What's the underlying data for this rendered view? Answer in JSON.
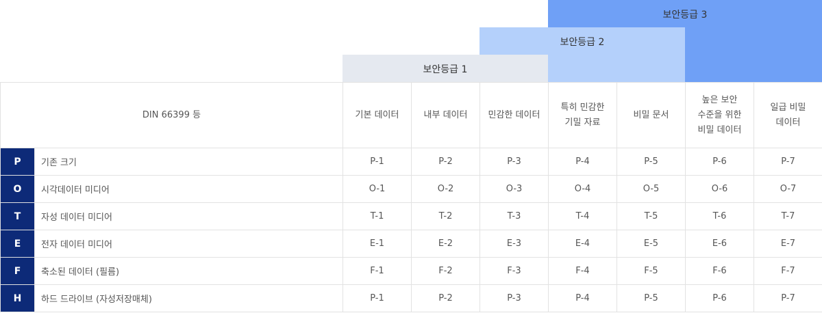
{
  "levels": [
    {
      "label": "보안등급 1"
    },
    {
      "label": "보안등급 2"
    },
    {
      "label": "보안등급 3"
    }
  ],
  "table": {
    "corner_label": "DIN 66399 등",
    "columns": [
      "기본 데이터",
      "내부 데이터",
      "민감한 데이터",
      "특히 민감한\n기밀 자료",
      "비밀 문서",
      "높은 보안\n수준을 위한\n비밀 데이터",
      "일급 비밀\n데이터"
    ],
    "rows": [
      {
        "letter": "P",
        "label": "기존 크기",
        "cells": [
          "P-1",
          "P-2",
          "P-3",
          "P-4",
          "P-5",
          "P-6",
          "P-7"
        ]
      },
      {
        "letter": "O",
        "label": "시각데이터 미디어",
        "cells": [
          "O-1",
          "O-2",
          "O-3",
          "O-4",
          "O-5",
          "O-6",
          "O-7"
        ]
      },
      {
        "letter": "T",
        "label": "자성 데이터 미디어",
        "cells": [
          "T-1",
          "T-2",
          "T-3",
          "T-4",
          "T-5",
          "T-6",
          "T-7"
        ]
      },
      {
        "letter": "E",
        "label": "전자 데이터 미디어",
        "cells": [
          "E-1",
          "E-2",
          "E-3",
          "E-4",
          "E-5",
          "E-6",
          "E-7"
        ]
      },
      {
        "letter": "F",
        "label": "축소된 데이터 (필름)",
        "cells": [
          "F-1",
          "F-2",
          "F-3",
          "F-4",
          "F-5",
          "F-6",
          "F-7"
        ]
      },
      {
        "letter": "H",
        "label": "하드 드라이브 (자성저장매체)",
        "cells": [
          "P-1",
          "P-2",
          "P-3",
          "P-4",
          "P-5",
          "P-6",
          "P-7"
        ]
      }
    ]
  },
  "colors": {
    "level1": "#e5e9f0",
    "level2": "#b4d0fb",
    "level3": "#6fa0f6",
    "letter_bg": "#0d2a78"
  }
}
